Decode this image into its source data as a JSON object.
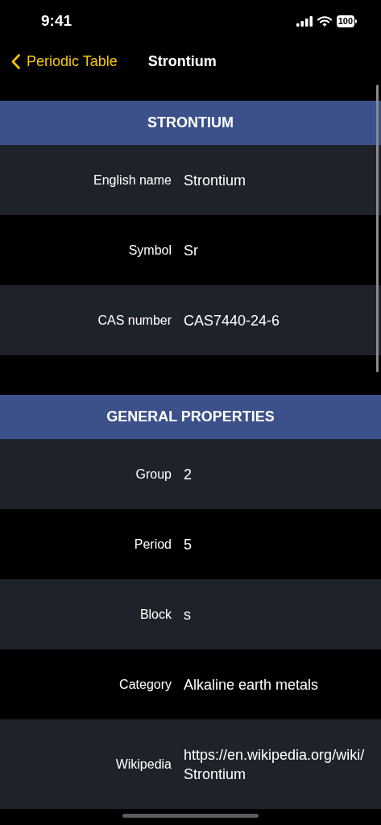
{
  "status_bar": {
    "time": "9:41",
    "battery": "100"
  },
  "nav_bar": {
    "back_label": "Periodic Table",
    "title": "Strontium"
  },
  "sections": [
    {
      "title": "STRONTIUM",
      "rows": [
        {
          "label": "English name",
          "value": "Strontium"
        },
        {
          "label": "Symbol",
          "value": "Sr"
        },
        {
          "label": "CAS number",
          "value": "CAS7440-24-6"
        }
      ]
    },
    {
      "title": "GENERAL PROPERTIES",
      "rows": [
        {
          "label": "Group",
          "value": "2"
        },
        {
          "label": "Period",
          "value": "5"
        },
        {
          "label": "Block",
          "value": "s"
        },
        {
          "label": "Category",
          "value": "Alkaline earth metals"
        },
        {
          "label": "Wikipedia",
          "value": "https://en.wikipedia.org/wiki/Strontium"
        }
      ]
    }
  ]
}
